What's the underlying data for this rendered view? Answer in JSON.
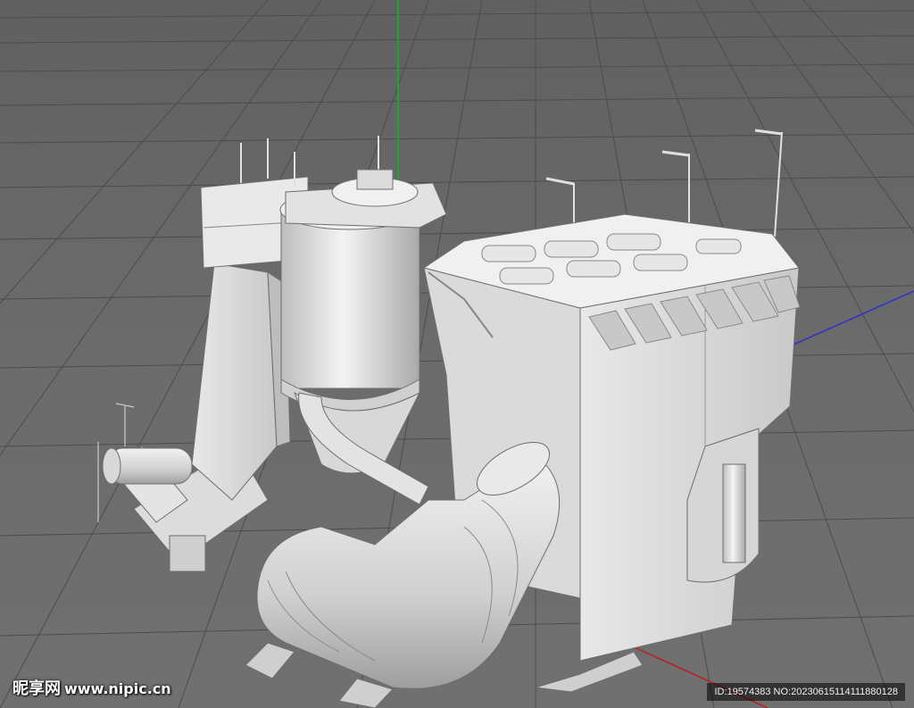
{
  "viewport": {
    "scene_subject": "3d-model-industrial-boiler",
    "axis_colors": {
      "x": "#3030c8",
      "y": "#19a82a",
      "z": "#b82020"
    },
    "grid_color": "#4a4a4a",
    "background_color": "#6b6b6b",
    "model_color": "#e6e6e6"
  },
  "watermark": {
    "brand": "昵享网",
    "site": "www.nipic.cn"
  },
  "id_strip": {
    "text": "ID:19574383 NO:20230615114111880128"
  }
}
